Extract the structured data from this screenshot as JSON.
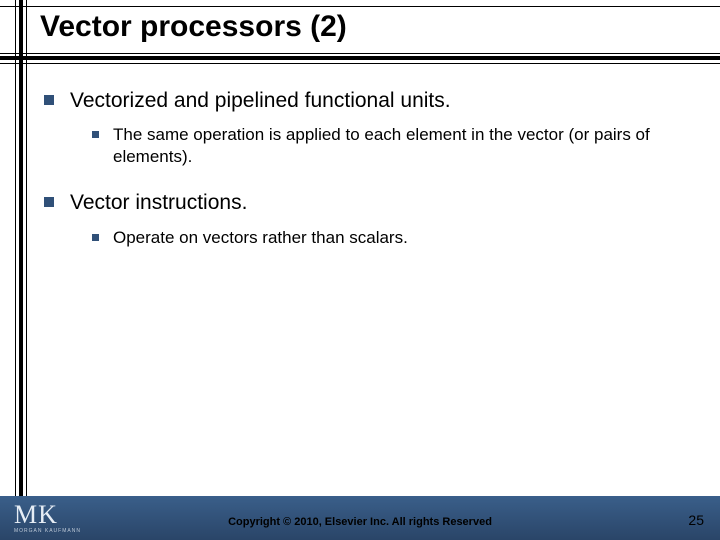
{
  "title": "Vector processors (2)",
  "bullets": [
    {
      "text": "Vectorized and pipelined functional units.",
      "sub": [
        "The same operation is applied to each element in the vector (or pairs of elements)."
      ]
    },
    {
      "text": "Vector instructions.",
      "sub": [
        "Operate on vectors rather than scalars."
      ]
    }
  ],
  "footer": {
    "copyright": "Copyright © 2010, Elsevier Inc. All rights Reserved",
    "page_number": "25",
    "logo_main": "MK",
    "logo_sub": "MORGAN KAUFMANN"
  }
}
